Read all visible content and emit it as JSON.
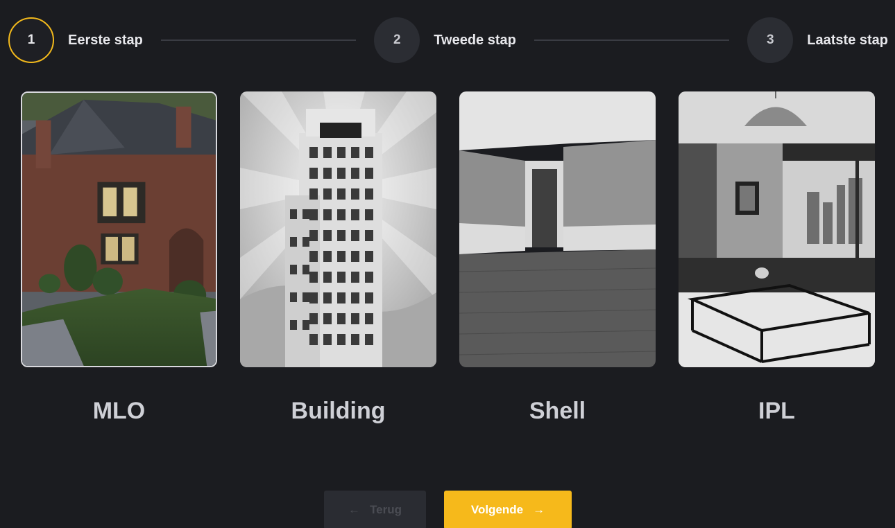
{
  "stepper": {
    "steps": [
      {
        "number": "1",
        "label": "Eerste stap",
        "active": true
      },
      {
        "number": "2",
        "label": "Tweede stap",
        "active": false
      },
      {
        "number": "3",
        "label": "Laatste stap",
        "active": false
      }
    ]
  },
  "cards": [
    {
      "title": "MLO",
      "selected": true
    },
    {
      "title": "Building",
      "selected": false
    },
    {
      "title": "Shell",
      "selected": false
    },
    {
      "title": "IPL",
      "selected": false
    }
  ],
  "buttons": {
    "back": {
      "label": "Terug",
      "arrow": "←",
      "disabled": true
    },
    "next": {
      "label": "Volgende",
      "arrow": "→"
    }
  },
  "colors": {
    "background": "#1b1c20",
    "accent": "#f6b91b",
    "step_inactive": "#2b2d33"
  }
}
